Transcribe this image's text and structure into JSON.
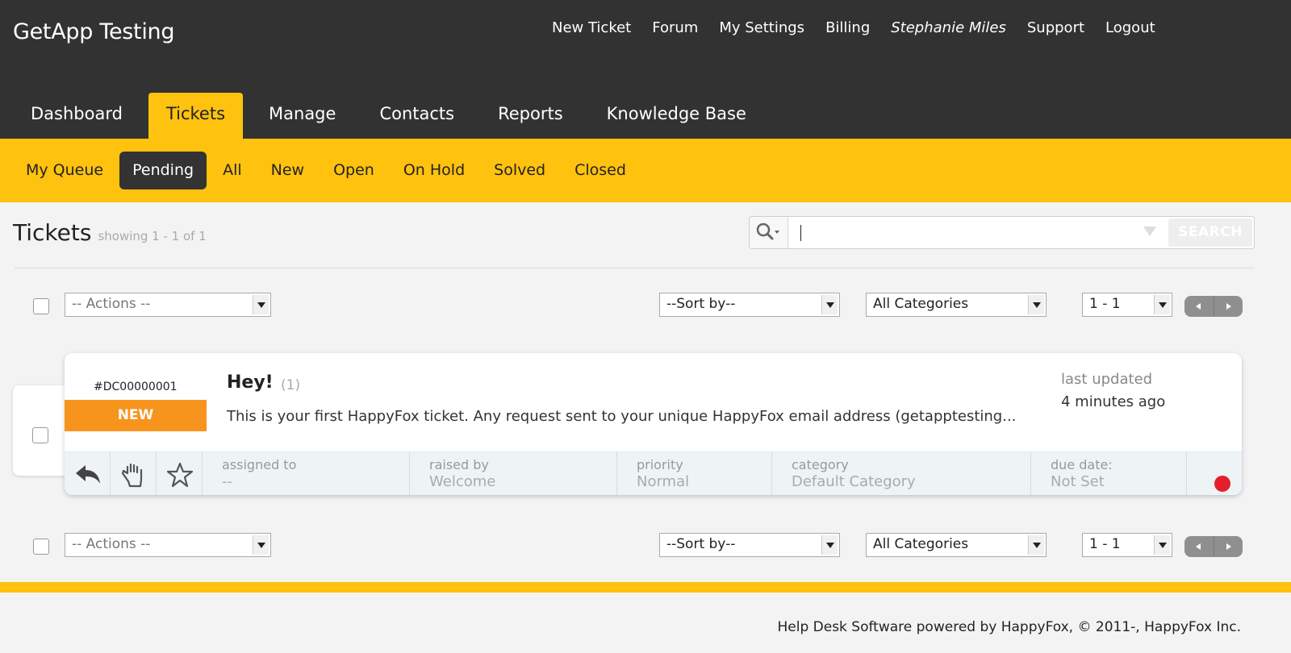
{
  "header": {
    "brand": "GetApp Testing",
    "links": [
      "New Ticket",
      "Forum",
      "My Settings",
      "Billing",
      "Stephanie Miles",
      "Support",
      "Logout"
    ]
  },
  "main_tabs": [
    "Dashboard",
    "Tickets",
    "Manage",
    "Contacts",
    "Reports",
    "Knowledge Base"
  ],
  "active_main_tab": "Tickets",
  "sub_tabs": [
    "My Queue",
    "Pending",
    "All",
    "New",
    "Open",
    "On Hold",
    "Solved",
    "Closed"
  ],
  "active_sub_tab": "Pending",
  "tickets_header": {
    "title": "Tickets",
    "count": "showing 1 - 1 of 1"
  },
  "search": {
    "value": "",
    "button_label": "SEARCH"
  },
  "controls": {
    "actions": "-- Actions --",
    "sort_by": "--Sort by--",
    "categories": "All Categories",
    "range": "1 - 1"
  },
  "ticket": {
    "id": "#DC00000001",
    "status": "NEW",
    "subject": "Hey!",
    "reply_count": "(1)",
    "excerpt": "This is your first HappyFox ticket. Any request sent to your unique HappyFox email address (getapptesting...",
    "last_updated_label": "last updated",
    "last_updated_value": "4 minutes ago",
    "meta": {
      "assigned_to_label": "assigned to",
      "assigned_to_value": "--",
      "raised_by_label": "raised by",
      "raised_by_value": "Welcome",
      "priority_label": "priority",
      "priority_value": "Normal",
      "category_label": "category",
      "category_value": "Default Category",
      "due_date_label": "due date:",
      "due_date_value": "Not Set"
    },
    "icons": [
      "reply-icon",
      "hand-icon",
      "star-icon"
    ],
    "status_dot_color": "#e51f2a"
  },
  "footer": {
    "text": "Help Desk Software powered by HappyFox, © 2011-, HappyFox Inc."
  },
  "colors": {
    "accent": "#ffc20e",
    "header_bg": "#323232",
    "new_badge": "#f7941d"
  }
}
